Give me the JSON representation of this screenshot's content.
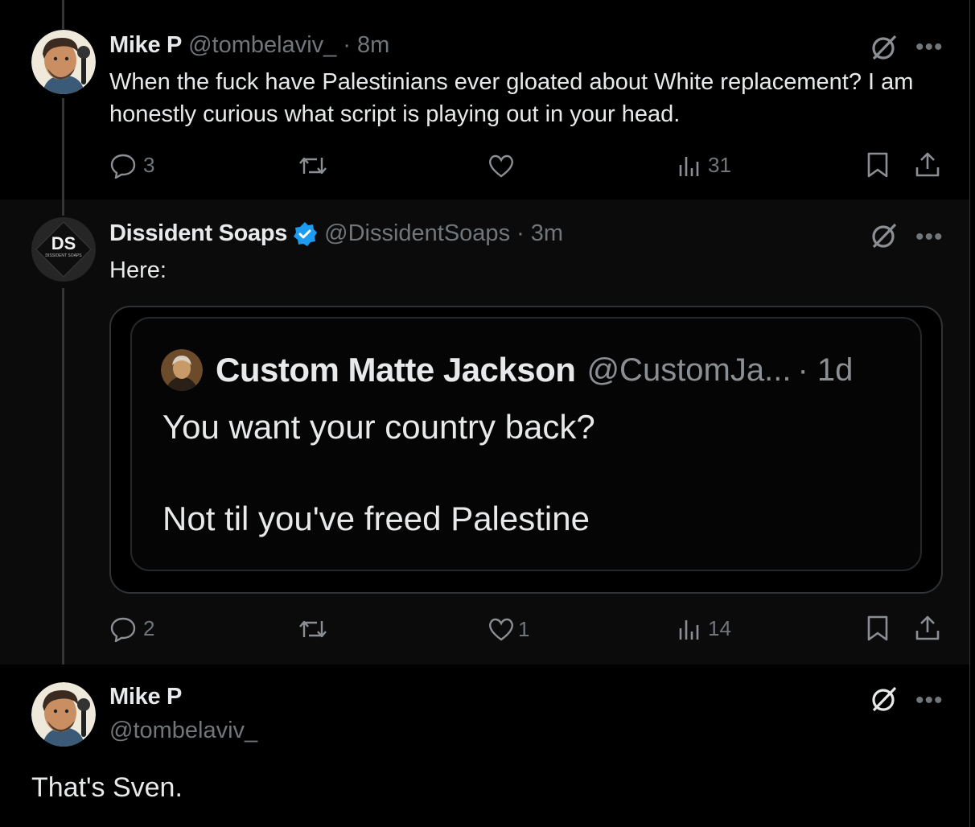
{
  "tweets": [
    {
      "name": "Mike P",
      "handle": "@tombelaviv_",
      "time": "· 8m",
      "text": "When the fuck have Palestinians ever gloated about White replacement? I am honestly curious what script is playing out in your head.",
      "replies": "3",
      "reposts": "",
      "likes": "",
      "views": "31"
    },
    {
      "name": "Dissident Soaps",
      "handle": "@DissidentSoaps",
      "time": "· 3m",
      "text": "Here:",
      "avatar_text": "DS",
      "avatar_subtext": "DISSIDENT SOAPS",
      "replies": "2",
      "reposts": "",
      "likes": "1",
      "views": "14",
      "quote": {
        "name": "Custom Matte Jackson",
        "handle": "@CustomJa...",
        "time": "· 1d",
        "line1": "You want your country back?",
        "line2": "Not til you've freed Palestine"
      }
    },
    {
      "name": "Mike P",
      "handle": "@tombelaviv_",
      "text": "That's Sven."
    }
  ],
  "icons": {
    "reply": "reply-icon",
    "repost": "repost-icon",
    "like": "like-icon",
    "views": "views-icon",
    "bookmark": "bookmark-icon",
    "share": "share-icon",
    "grok": "grok-icon",
    "more": "more-icon",
    "verified": "verified-badge-icon"
  },
  "colors": {
    "background": "#000000",
    "text": "#e7e9ea",
    "muted": "#71767b",
    "verified": "#1d9bf0"
  }
}
